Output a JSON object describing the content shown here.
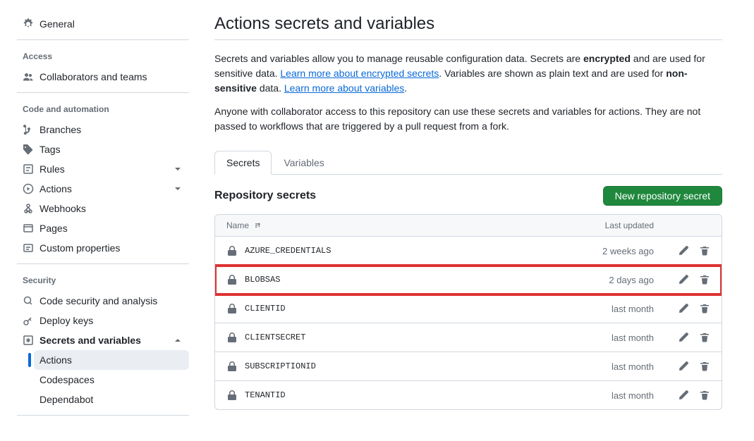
{
  "sidebar": {
    "general": "General",
    "groups": {
      "access": {
        "heading": "Access",
        "collaborators": "Collaborators and teams"
      },
      "code": {
        "heading": "Code and automation",
        "branches": "Branches",
        "tags": "Tags",
        "rules": "Rules",
        "actions": "Actions",
        "webhooks": "Webhooks",
        "pages": "Pages",
        "custom_properties": "Custom properties"
      },
      "security": {
        "heading": "Security",
        "code_security": "Code security and analysis",
        "deploy_keys": "Deploy keys",
        "secrets_vars": "Secrets and variables",
        "sub": {
          "actions": "Actions",
          "codespaces": "Codespaces",
          "dependabot": "Dependabot"
        }
      }
    }
  },
  "page": {
    "title": "Actions secrets and variables",
    "desc_pre": "Secrets and variables allow you to manage reusable configuration data. Secrets are ",
    "desc_encrypted": "encrypted",
    "desc_mid": " and are used for sensitive data. ",
    "link_secrets": "Learn more about encrypted secrets",
    "desc_after_link1": ". Variables are shown as plain text and are used for ",
    "desc_nonsensitive": "non-sensitive",
    "desc_after_non": " data. ",
    "link_variables": "Learn more about variables",
    "desc_period": ".",
    "desc2": "Anyone with collaborator access to this repository can use these secrets and variables for actions. They are not passed to workflows that are triggered by a pull request from a fork."
  },
  "tabs": {
    "secrets": "Secrets",
    "variables": "Variables"
  },
  "section": {
    "title": "Repository secrets",
    "new_button": "New repository secret"
  },
  "table": {
    "headers": {
      "name": "Name",
      "updated": "Last updated"
    },
    "rows": [
      {
        "name": "AZURE_CREDENTIALS",
        "updated": "2 weeks ago",
        "highlighted": false
      },
      {
        "name": "BLOBSAS",
        "updated": "2 days ago",
        "highlighted": true
      },
      {
        "name": "CLIENTID",
        "updated": "last month",
        "highlighted": false
      },
      {
        "name": "CLIENTSECRET",
        "updated": "last month",
        "highlighted": false
      },
      {
        "name": "SUBSCRIPTIONID",
        "updated": "last month",
        "highlighted": false
      },
      {
        "name": "TENANTID",
        "updated": "last month",
        "highlighted": false
      }
    ]
  }
}
